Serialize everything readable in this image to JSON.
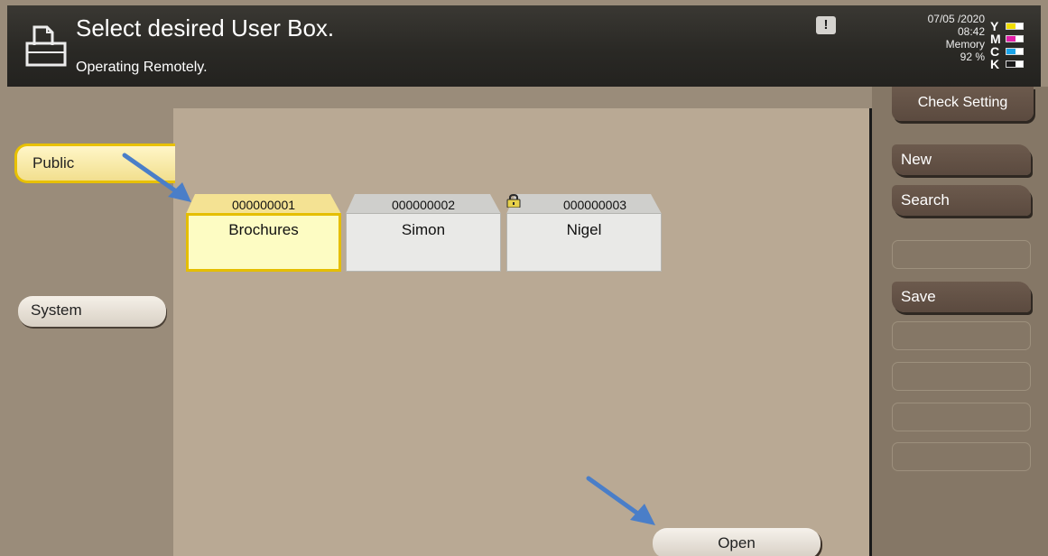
{
  "header": {
    "title": "Select desired User Box.",
    "subtitle": "Operating Remotely.",
    "warning_glyph": "!",
    "date": "07/05 /2020",
    "time": "08:42",
    "memory_label": "Memory",
    "memory_value": "92 %"
  },
  "toner": [
    {
      "letter": "Y",
      "color": "#f1df00"
    },
    {
      "letter": "M",
      "color": "#e21fa8"
    },
    {
      "letter": "C",
      "color": "#1aa3e8"
    },
    {
      "letter": "K",
      "color": "#1a1a1a"
    }
  ],
  "tabs": {
    "public": "Public",
    "system": "System"
  },
  "boxes": [
    {
      "number": "000000001",
      "name": "Brochures",
      "selected": true,
      "locked": false
    },
    {
      "number": "000000002",
      "name": "Simon",
      "selected": false,
      "locked": false
    },
    {
      "number": "000000003",
      "name": "Nigel",
      "selected": false,
      "locked": true
    }
  ],
  "right_panel": {
    "check_setting": "Check Setting",
    "new": "New",
    "search": "Search",
    "save": "Save"
  },
  "open_button": "Open",
  "colors": {
    "selected_yellow": "#fdfcc3",
    "accent_border": "#e5be00",
    "arrow_blue": "#4a7ec8"
  },
  "icons": {
    "header": "user-box-icon",
    "warning": "warning-icon",
    "lock": "lock-icon",
    "annotation": "arrow-icon"
  }
}
